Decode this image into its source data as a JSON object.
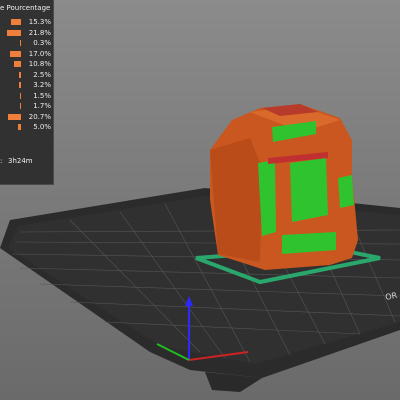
{
  "legend": {
    "header_prefix": "e",
    "header_title": "Pourcentage",
    "rows": [
      {
        "value": 0.153,
        "pct": "15.3%"
      },
      {
        "value": 0.218,
        "pct": "21.8%"
      },
      {
        "value": 0.003,
        "pct": "0.3%"
      },
      {
        "value": 0.17,
        "pct": "17.0%"
      },
      {
        "value": 0.108,
        "pct": "10.8%"
      },
      {
        "value": 0.025,
        "pct": "2.5%"
      },
      {
        "value": 0.032,
        "pct": "3.2%"
      },
      {
        "value": 0.015,
        "pct": "1.5%"
      },
      {
        "value": 0.017,
        "pct": "1.7%"
      },
      {
        "value": 0.207,
        "pct": "20.7%"
      },
      {
        "value": 0.05,
        "pct": "5.0%"
      }
    ],
    "time_label": ":",
    "time_value": "3h24m"
  },
  "bed": {
    "label": "OR"
  },
  "colors": {
    "bar": "#ef7f3a",
    "panel": "#2a2a2a",
    "infill": "#c9571f",
    "top_solid": "#2fc42f",
    "bed": "#2b2b2b",
    "grid": "#5a5a5a",
    "skirt": "#2aa76d",
    "axis_z": "#2a2aff",
    "axis_x": "#cc2222",
    "axis_y": "#22bb22"
  }
}
